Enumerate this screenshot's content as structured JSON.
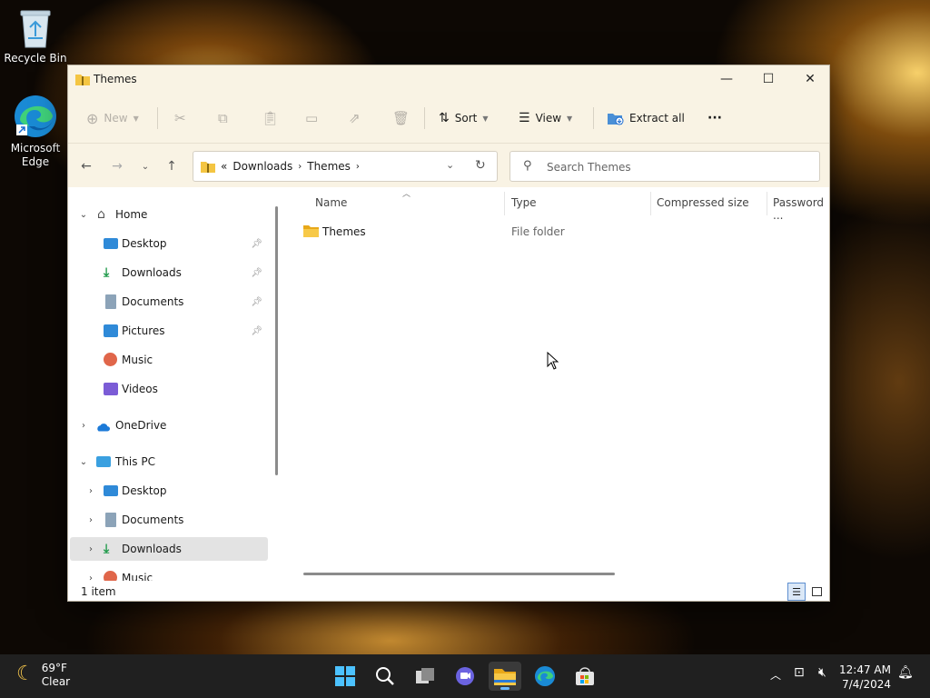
{
  "desktop": {
    "icons": [
      {
        "label": "Recycle Bin"
      },
      {
        "label": "Microsoft Edge"
      }
    ]
  },
  "window": {
    "title": "Themes",
    "controls": {
      "minimize": "—",
      "maximize": "☐",
      "close": "✕"
    }
  },
  "toolbar": {
    "new_label": "New",
    "sort_label": "Sort",
    "view_label": "View",
    "extract_label": "Extract all",
    "more_label": "···"
  },
  "address": {
    "overflow": "«",
    "crumbs": [
      "Downloads",
      "Themes"
    ],
    "search_placeholder": "Search Themes"
  },
  "nav": {
    "home": "Home",
    "quick_access": [
      "Desktop",
      "Downloads",
      "Documents",
      "Pictures",
      "Music",
      "Videos"
    ],
    "onedrive": "OneDrive",
    "this_pc": "This PC",
    "pc_items": [
      "Desktop",
      "Documents",
      "Downloads",
      "Music"
    ]
  },
  "content": {
    "columns": [
      "Name",
      "Type",
      "Compressed size",
      "Password ..."
    ],
    "rows": [
      {
        "name": "Themes",
        "type": "File folder"
      }
    ]
  },
  "status": {
    "count": "1 item"
  },
  "taskbar": {
    "weather_temp": "69°F",
    "weather_desc": "Clear",
    "time": "12:47 AM",
    "date": "7/4/2024"
  },
  "colors": {
    "accent": "#0067c0",
    "folder": "#f4c542",
    "taskbar": "#202020"
  }
}
